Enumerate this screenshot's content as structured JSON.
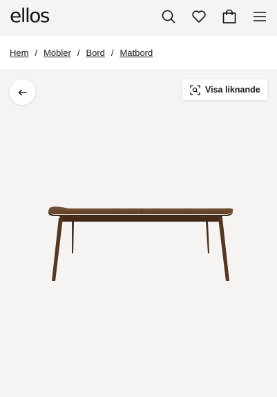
{
  "header": {
    "logo": "ellos",
    "icons": [
      "search-icon",
      "heart-icon",
      "bag-icon",
      "menu-icon"
    ]
  },
  "breadcrumb": {
    "items": [
      "Hem",
      "Möbler",
      "Bord",
      "Matbord"
    ],
    "separator": "/"
  },
  "gallery": {
    "back_icon": "arrow-left-icon",
    "similar_label": "Visa liknande",
    "similar_icon": "visual-search-icon",
    "product_image": "walnut-dining-table"
  },
  "colors": {
    "background": "#f5f4f2",
    "text": "#1a1a1a",
    "wood": "#5a3a22"
  }
}
